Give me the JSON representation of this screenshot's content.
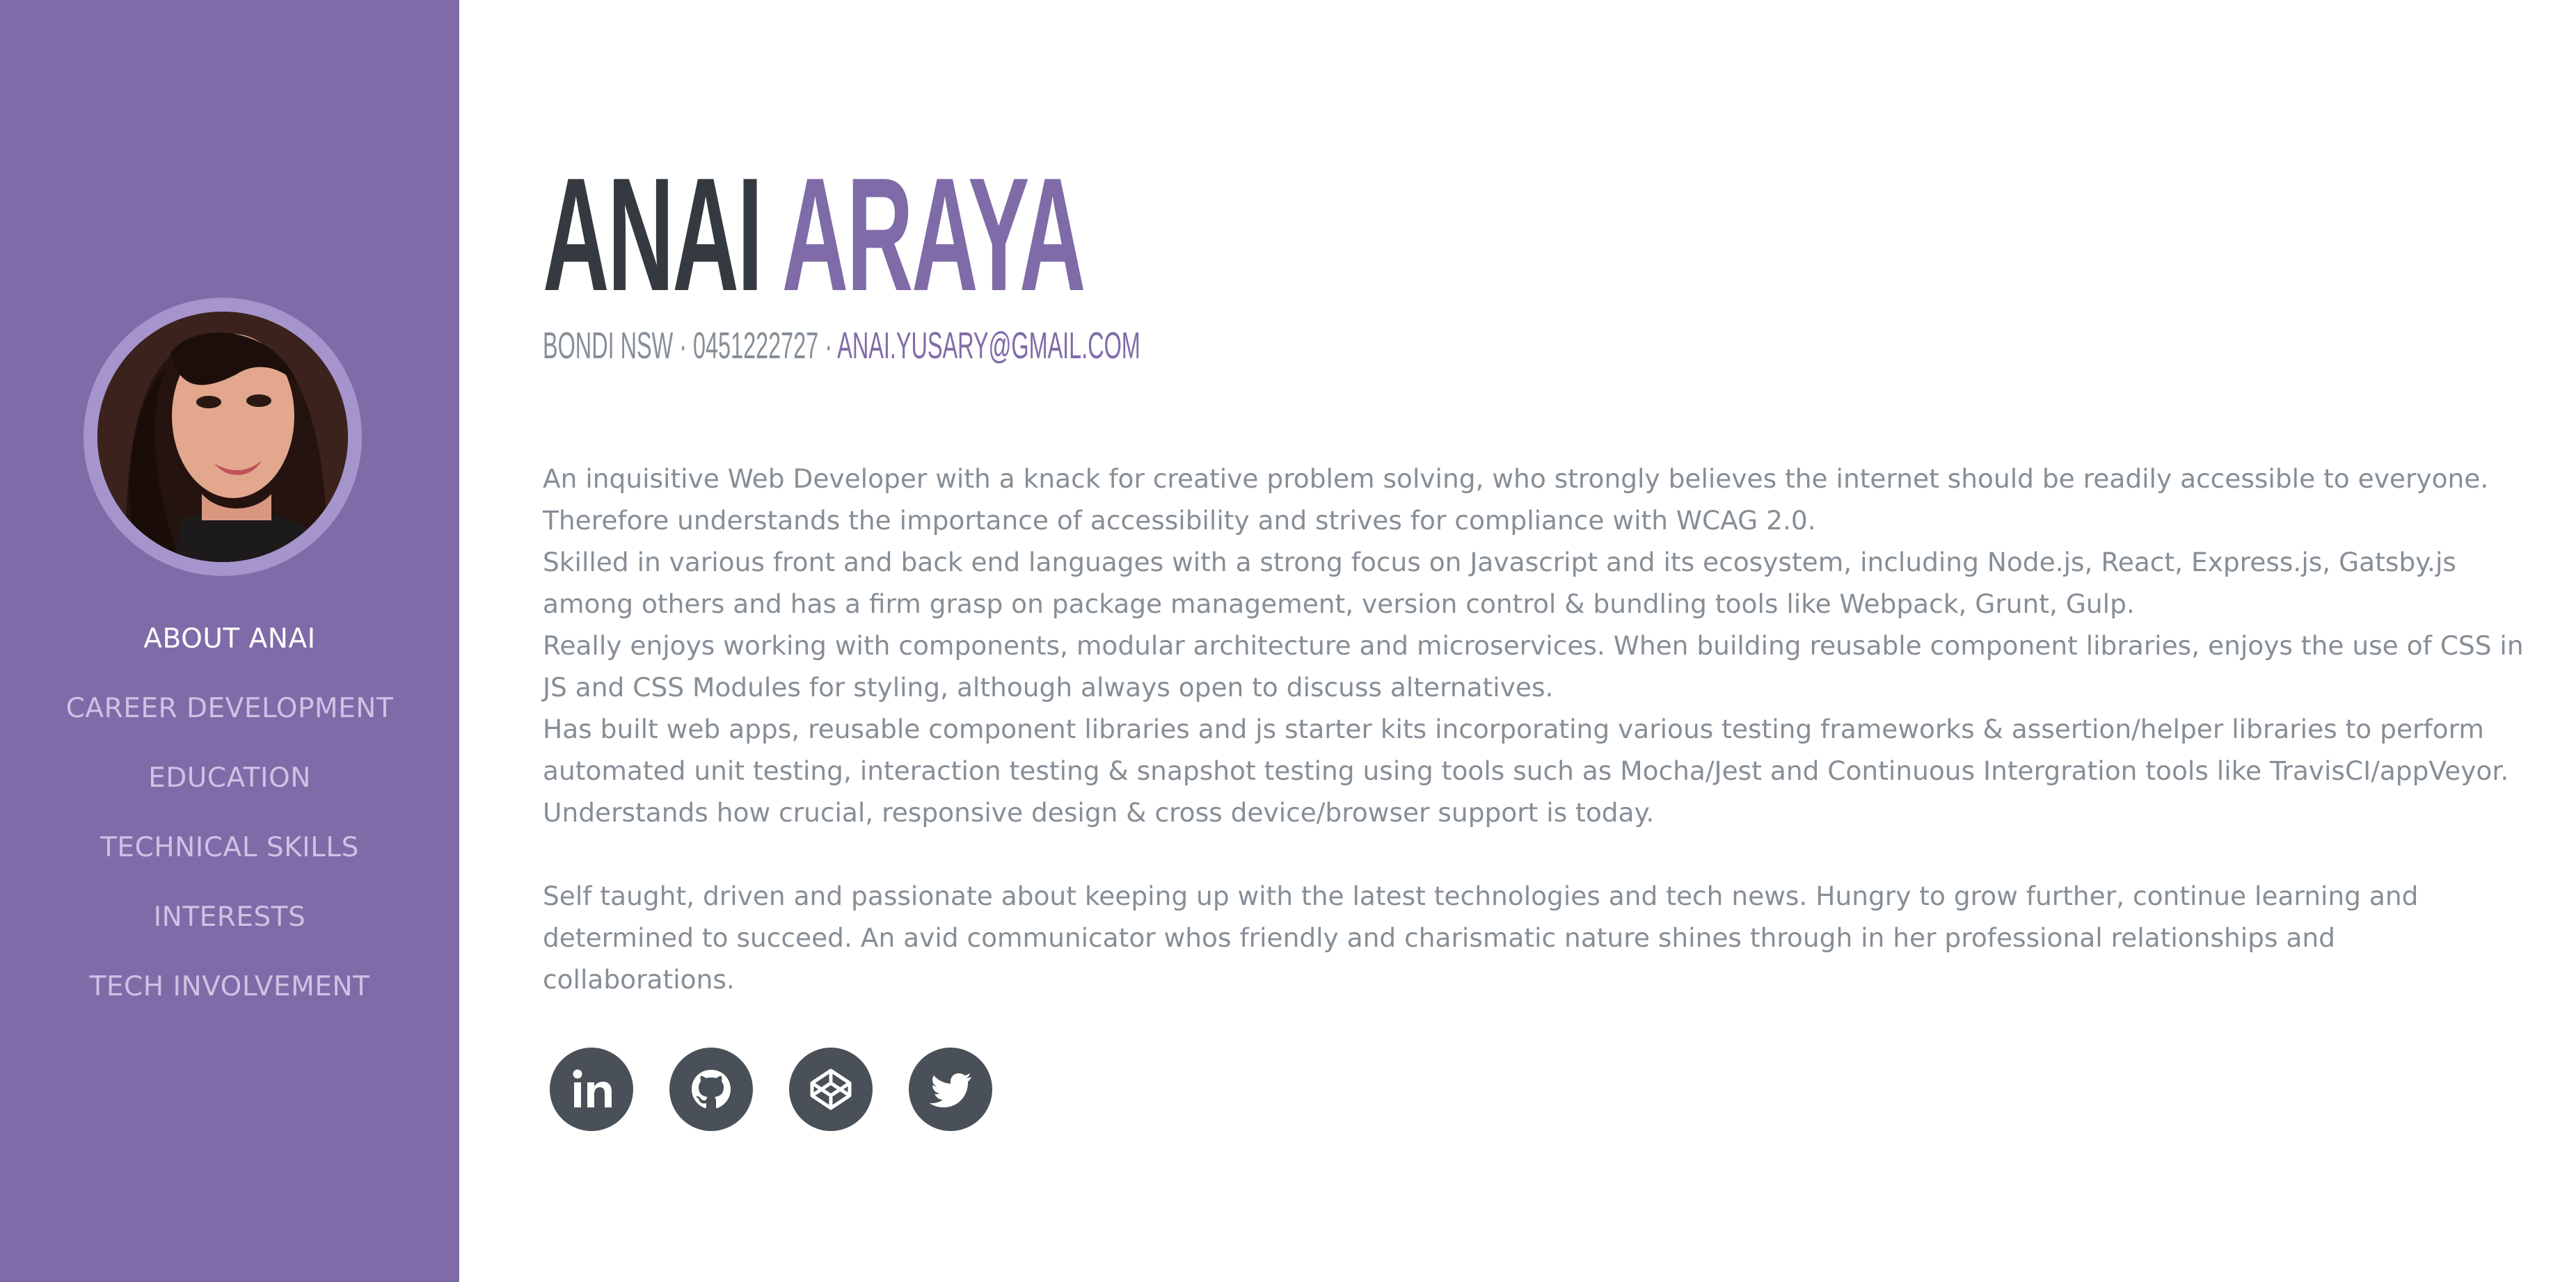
{
  "sidebar": {
    "nav": [
      "ABOUT ANAI",
      "CAREER DEVELOPMENT",
      "EDUCATION",
      "TECHNICAL SKILLS",
      "INTERESTS",
      "TECH INVOLVEMENT"
    ],
    "active_index": 0
  },
  "header": {
    "first_name": "ANAI",
    "last_name": "ARAYA",
    "location": "BONDI NSW",
    "separator": " · ",
    "phone": "0451222727",
    "email": "ANAI.YUSARY@GMAIL.COM"
  },
  "bio": {
    "paragraphs": [
      "An inquisitive Web Developer with a knack for creative problem solving, who strongly believes the internet should be readily accessible to everyone. Therefore understands the importance of accessibility and strives for compliance with WCAG 2.0.",
      "Skilled in various front and back end languages with a strong focus on Javascript and its ecosystem, including Node.js, React, Express.js, Gatsby.js among others and has a firm grasp on package management, version control & bundling tools like Webpack, Grunt, Gulp.",
      "Really enjoys working with components, modular architecture and microservices. When building reusable component libraries, enjoys the use of CSS in JS and CSS Modules for styling, although always open to discuss alternatives.",
      "Has built web apps, reusable component libraries and js starter kits incorporating various testing frameworks & assertion/helper libraries to perform automated unit testing, interaction testing & snapshot testing using tools such as Mocha/Jest and Continuous Intergration tools like TravisCI/appVeyor. Understands how crucial, responsive design & cross device/browser support is today.",
      "Self taught, driven and passionate about keeping up with the latest technologies and tech news. Hungry to grow further, continue learning and determined to succeed. An avid communicator whos friendly and charismatic nature shines through in her professional relationships and collaborations."
    ]
  },
  "social": [
    {
      "icon": "linkedin-icon"
    },
    {
      "icon": "github-icon"
    },
    {
      "icon": "codepen-icon"
    },
    {
      "icon": "twitter-icon"
    }
  ],
  "colors": {
    "sidebar_bg": "#7f6ba8",
    "accent": "#7f6ba8",
    "heading_dark": "#343a40",
    "body_text": "#868e96",
    "social_bg": "#495057",
    "nav_active": "#ffffff",
    "nav_inactive": "#cdc2e4"
  }
}
